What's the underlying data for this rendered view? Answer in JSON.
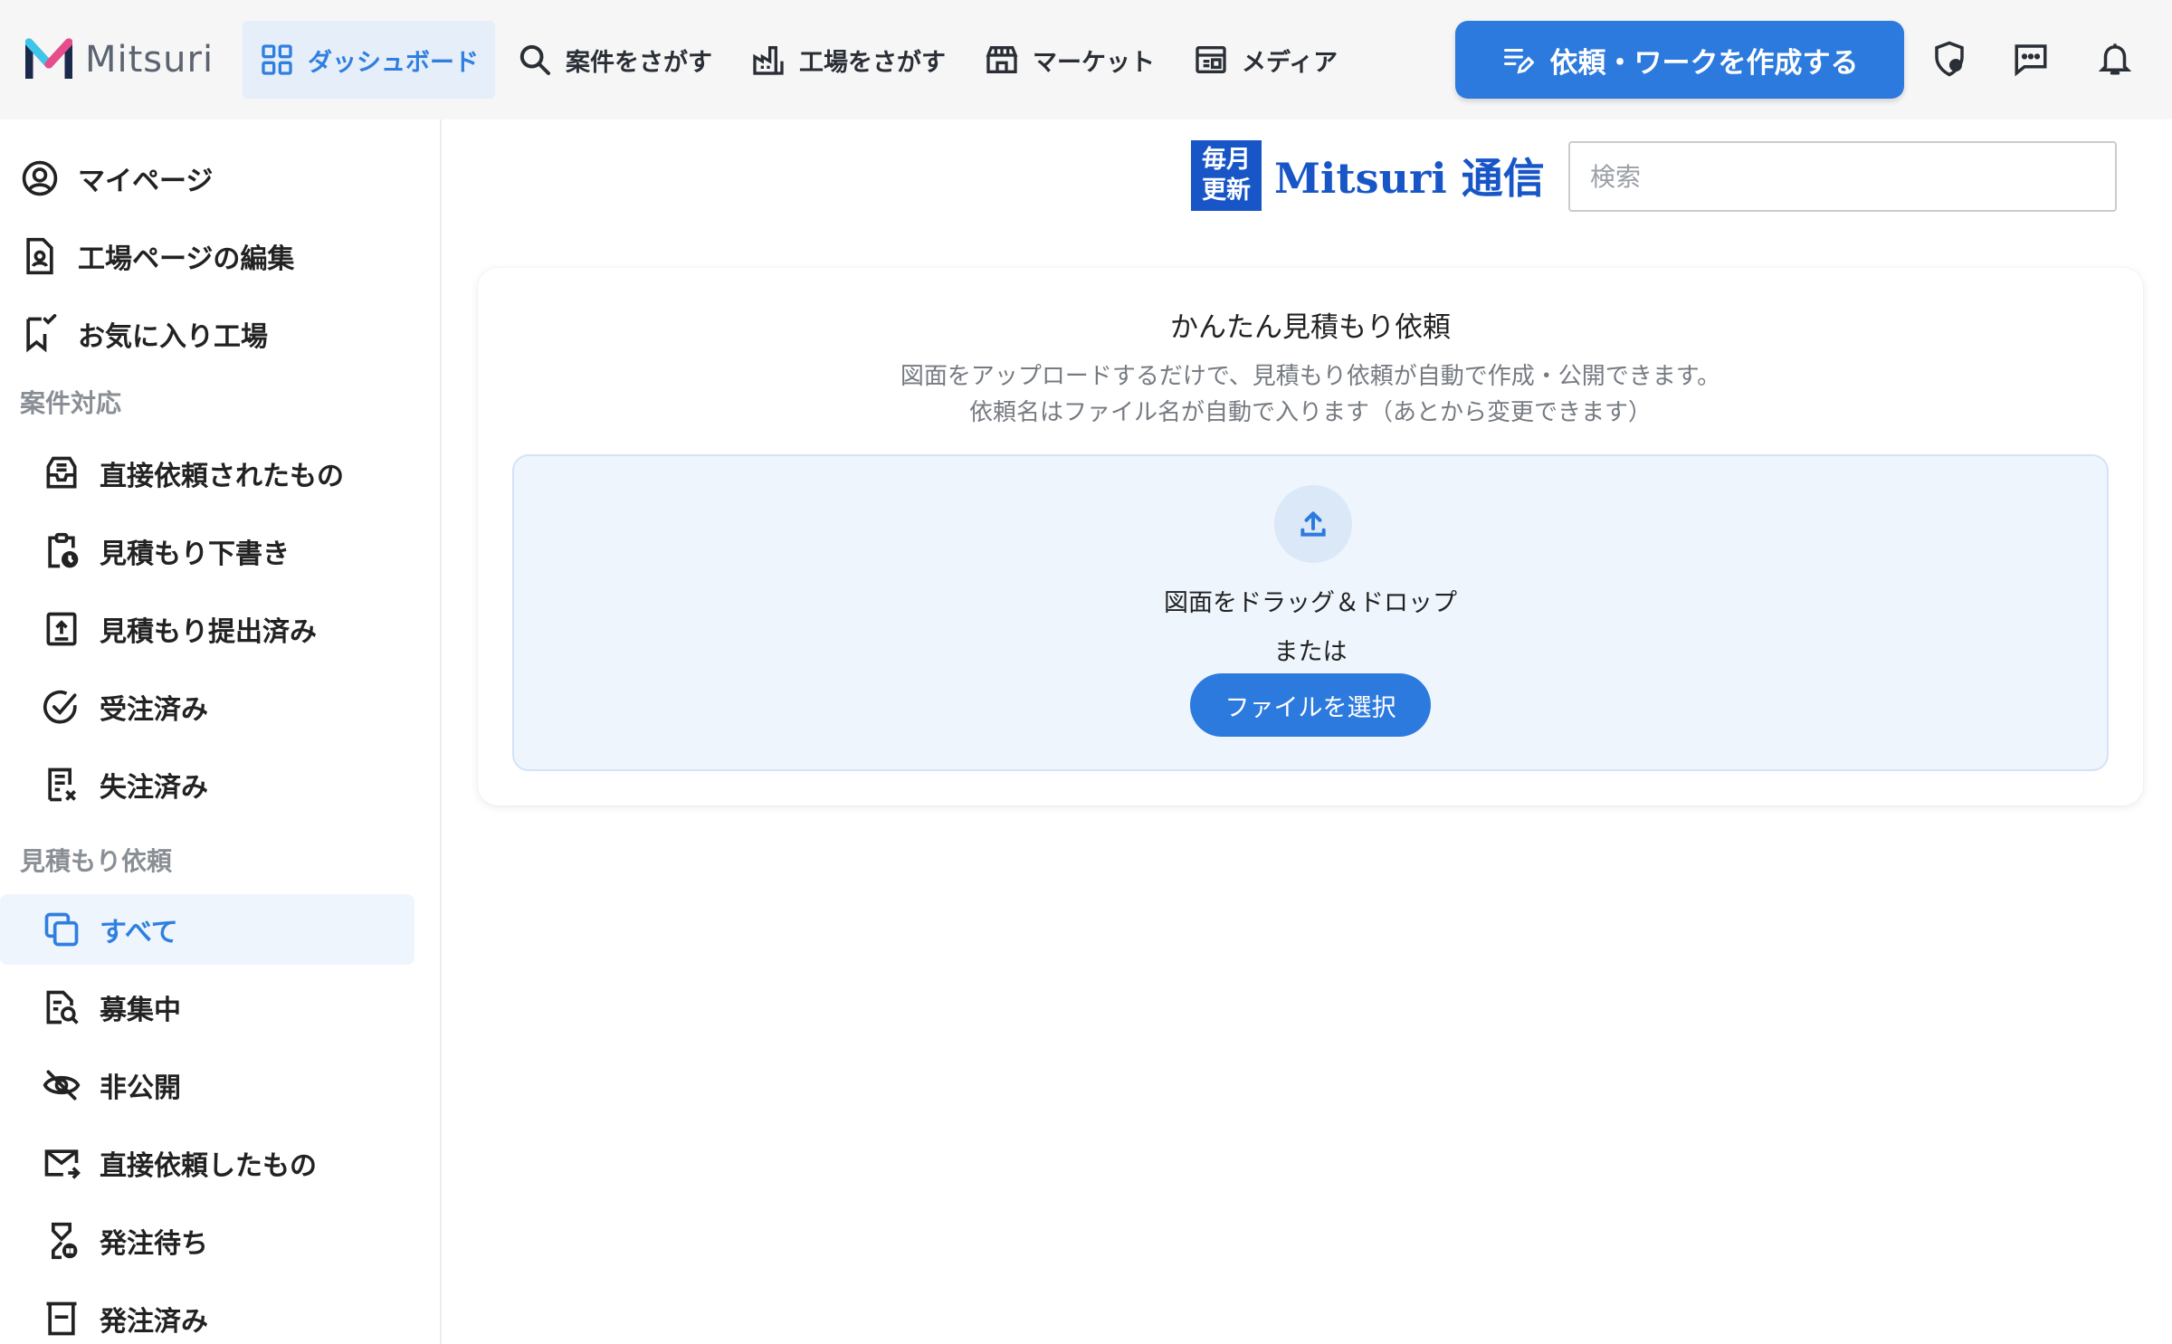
{
  "brand": {
    "name": "Mitsuri",
    "accent": "#2d7ade",
    "logo_colors": [
      "#1b2a4a",
      "#3ec6e8",
      "#e84c8b"
    ]
  },
  "nav": {
    "items": [
      {
        "label": "ダッシュボード",
        "icon": "grid-icon",
        "active": true
      },
      {
        "label": "案件をさがす",
        "icon": "search-icon"
      },
      {
        "label": "工場をさがす",
        "icon": "factory-icon"
      },
      {
        "label": "マーケット",
        "icon": "store-icon"
      },
      {
        "label": "メディア",
        "icon": "newspaper-icon"
      }
    ],
    "create_button": "依頼・ワークを作成する",
    "tools": [
      "shield-icon",
      "chat-icon",
      "bell-icon"
    ]
  },
  "sidebar": {
    "top_items": [
      {
        "label": "マイページ",
        "icon": "user-circle-icon"
      },
      {
        "label": "工場ページの編集",
        "icon": "document-person-icon"
      },
      {
        "label": "お気に入り工場",
        "icon": "bookmark-icon"
      }
    ],
    "section_1": {
      "title": "案件対応",
      "items": [
        {
          "label": "直接依頼されたもの",
          "icon": "inbox-icon"
        },
        {
          "label": "見積もり下書き",
          "icon": "clipboard-clock-icon"
        },
        {
          "label": "見積もり提出済み",
          "icon": "upload-box-icon"
        },
        {
          "label": "受注済み",
          "icon": "check-circle-icon"
        },
        {
          "label": "失注済み",
          "icon": "receipt-x-icon"
        }
      ]
    },
    "section_2": {
      "title": "見積もり依頼",
      "items": [
        {
          "label": "すべて",
          "icon": "copy-icon",
          "active": true
        },
        {
          "label": "募集中",
          "icon": "document-search-icon"
        },
        {
          "label": "非公開",
          "icon": "eye-off-icon"
        },
        {
          "label": "直接依頼したもの",
          "icon": "mail-send-icon"
        },
        {
          "label": "発注待ち",
          "icon": "hourglass-icon"
        },
        {
          "label": "発注済み",
          "icon": "tray-icon"
        }
      ]
    }
  },
  "banner": {
    "badge_line1": "毎月",
    "badge_line2": "更新",
    "text": "Mitsuri 通信"
  },
  "search": {
    "placeholder": "検索",
    "value": ""
  },
  "quote_card": {
    "title": "かんたん見積もり依頼",
    "desc_line1": "図面をアップロードするだけで、見積もり依頼が自動で作成・公開できます。",
    "desc_line2": "依頼名はファイル名が自動で入ります（あとから変更できます）",
    "dropzone_text": "図面をドラッグ＆ドロップ",
    "or_text": "または",
    "file_button": "ファイルを選択"
  }
}
